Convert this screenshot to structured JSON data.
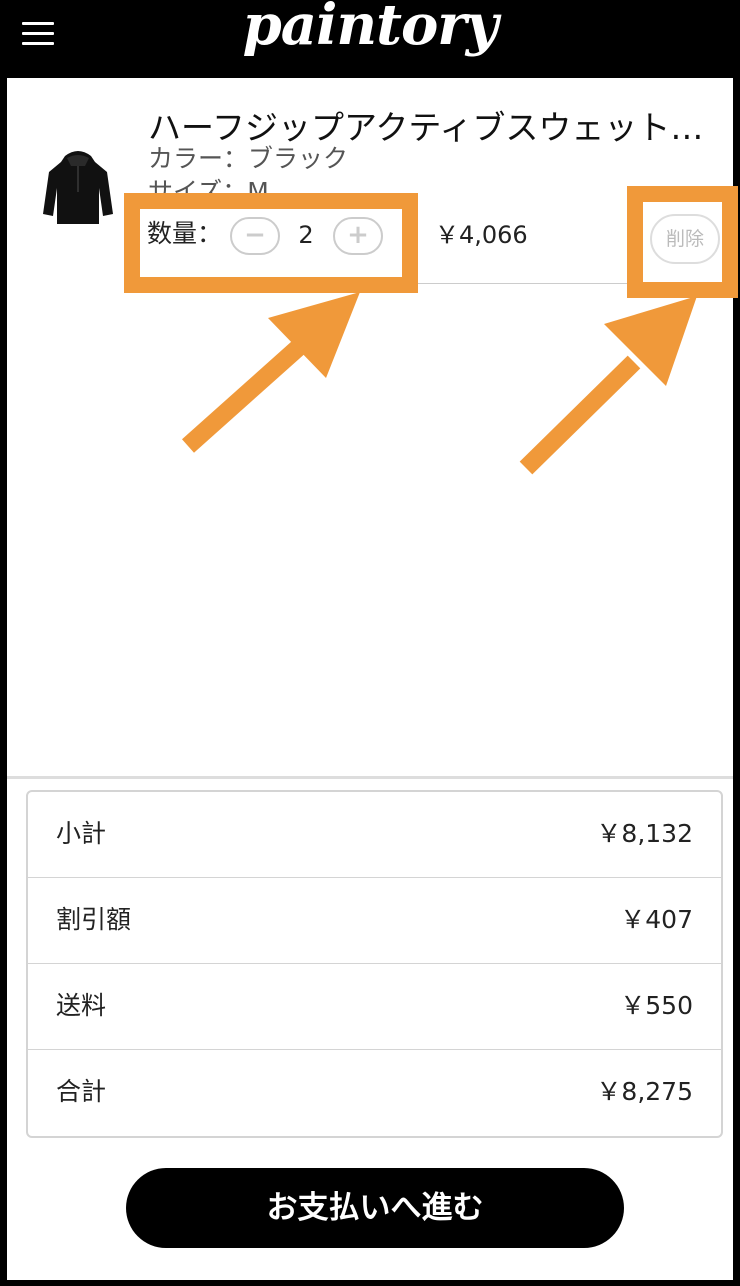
{
  "header": {
    "logo_text": "paintory",
    "menu_icon": "hamburger-menu-icon"
  },
  "cart_item": {
    "title": "ハーフジップアクティブスウェット…",
    "color": "カラー：ブラック",
    "size": "サイズ：M",
    "quantity_label": "数量：",
    "minus_symbol": "−",
    "quantity": "2",
    "plus_symbol": "+",
    "price": "￥4,066",
    "delete_label": "削除",
    "image_icon": "hoodie-product-image"
  },
  "summary": {
    "rows": [
      {
        "label": "小計",
        "value": "￥8,132"
      },
      {
        "label": "割引額",
        "value": "￥407"
      },
      {
        "label": "送料",
        "value": "￥550"
      },
      {
        "label": "合計",
        "value": "￥8,275"
      }
    ]
  },
  "checkout_button": "お支払いへ進む",
  "colors": {
    "highlight": "#f0993a",
    "header_bg": "#000000",
    "button_bg": "#000000"
  }
}
